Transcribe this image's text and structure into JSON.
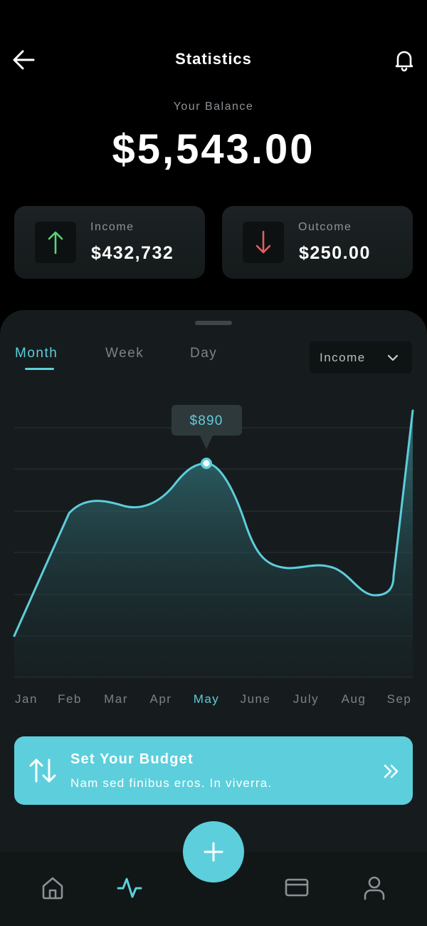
{
  "header": {
    "title": "Statistics"
  },
  "balance": {
    "label": "Your Balance",
    "value": "$5,543.00"
  },
  "cards": {
    "income": {
      "label": "Income",
      "value": "$432,732"
    },
    "outcome": {
      "label": "Outcome",
      "value": "$250.00"
    }
  },
  "tabs": [
    {
      "label": "Month",
      "active": true
    },
    {
      "label": "Week",
      "active": false
    },
    {
      "label": "Day",
      "active": false
    }
  ],
  "filter": {
    "selected": "Income"
  },
  "chart_data": {
    "type": "area",
    "categories": [
      "Jan",
      "Feb",
      "Mar",
      "Apr",
      "May",
      "June",
      "July",
      "Aug",
      "Sep"
    ],
    "highlight": {
      "category": "May",
      "label": "$890"
    }
  },
  "budget": {
    "title": "Set Your Budget",
    "subtitle": "Nam sed finibus eros. In viverra."
  },
  "colors": {
    "accent": "#5dcfdc",
    "income_arrow": "#5ed27a",
    "outcome_arrow": "#e0605e",
    "background": "#000000",
    "sheet": "#161c1e"
  },
  "nav": {
    "icons": [
      "home-icon",
      "activity-icon",
      "card-icon",
      "user-icon"
    ],
    "fab_icon": "plus-icon"
  }
}
